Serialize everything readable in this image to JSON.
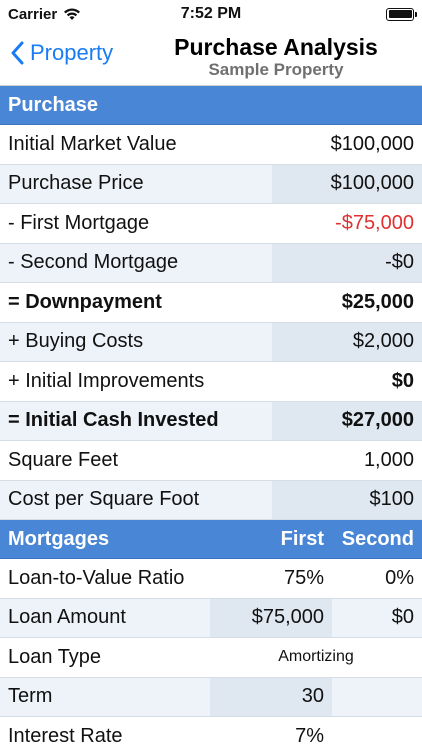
{
  "status": {
    "carrier": "Carrier",
    "time": "7:52 PM"
  },
  "nav": {
    "back_label": "Property",
    "title": "Purchase Analysis",
    "subtitle": "Sample Property"
  },
  "purchase": {
    "header": "Purchase",
    "rows": [
      {
        "label": "Initial Market Value",
        "value": "$100,000"
      },
      {
        "label": "Purchase Price",
        "value": "$100,000"
      },
      {
        "label": "- First Mortgage",
        "value": "-$75,000"
      },
      {
        "label": "- Second Mortgage",
        "value": "-$0"
      },
      {
        "label": "= Downpayment",
        "value": "$25,000"
      },
      {
        "label": "+ Buying Costs",
        "value": "$2,000"
      },
      {
        "label": "+ Initial Improvements",
        "value": "$0"
      },
      {
        "label": "= Initial Cash Invested",
        "value": "$27,000"
      },
      {
        "label": "Square Feet",
        "value": "1,000"
      },
      {
        "label": "Cost per Square Foot",
        "value": "$100"
      }
    ]
  },
  "mortgages": {
    "header": "Mortgages",
    "col_first": "First",
    "col_second": "Second",
    "rows": [
      {
        "label": "Loan-to-Value Ratio",
        "first": "75%",
        "second": "0%"
      },
      {
        "label": "Loan Amount",
        "first": "$75,000",
        "second": "$0"
      },
      {
        "label": "Loan Type",
        "span": "Amortizing"
      },
      {
        "label": "Term",
        "first": "30",
        "second": ""
      },
      {
        "label": "Interest Rate",
        "first": "7%",
        "second": ""
      }
    ]
  },
  "colors": {
    "accent": "#1a7cf2",
    "header_bg": "#4a86d6",
    "negative": "#e03030"
  }
}
